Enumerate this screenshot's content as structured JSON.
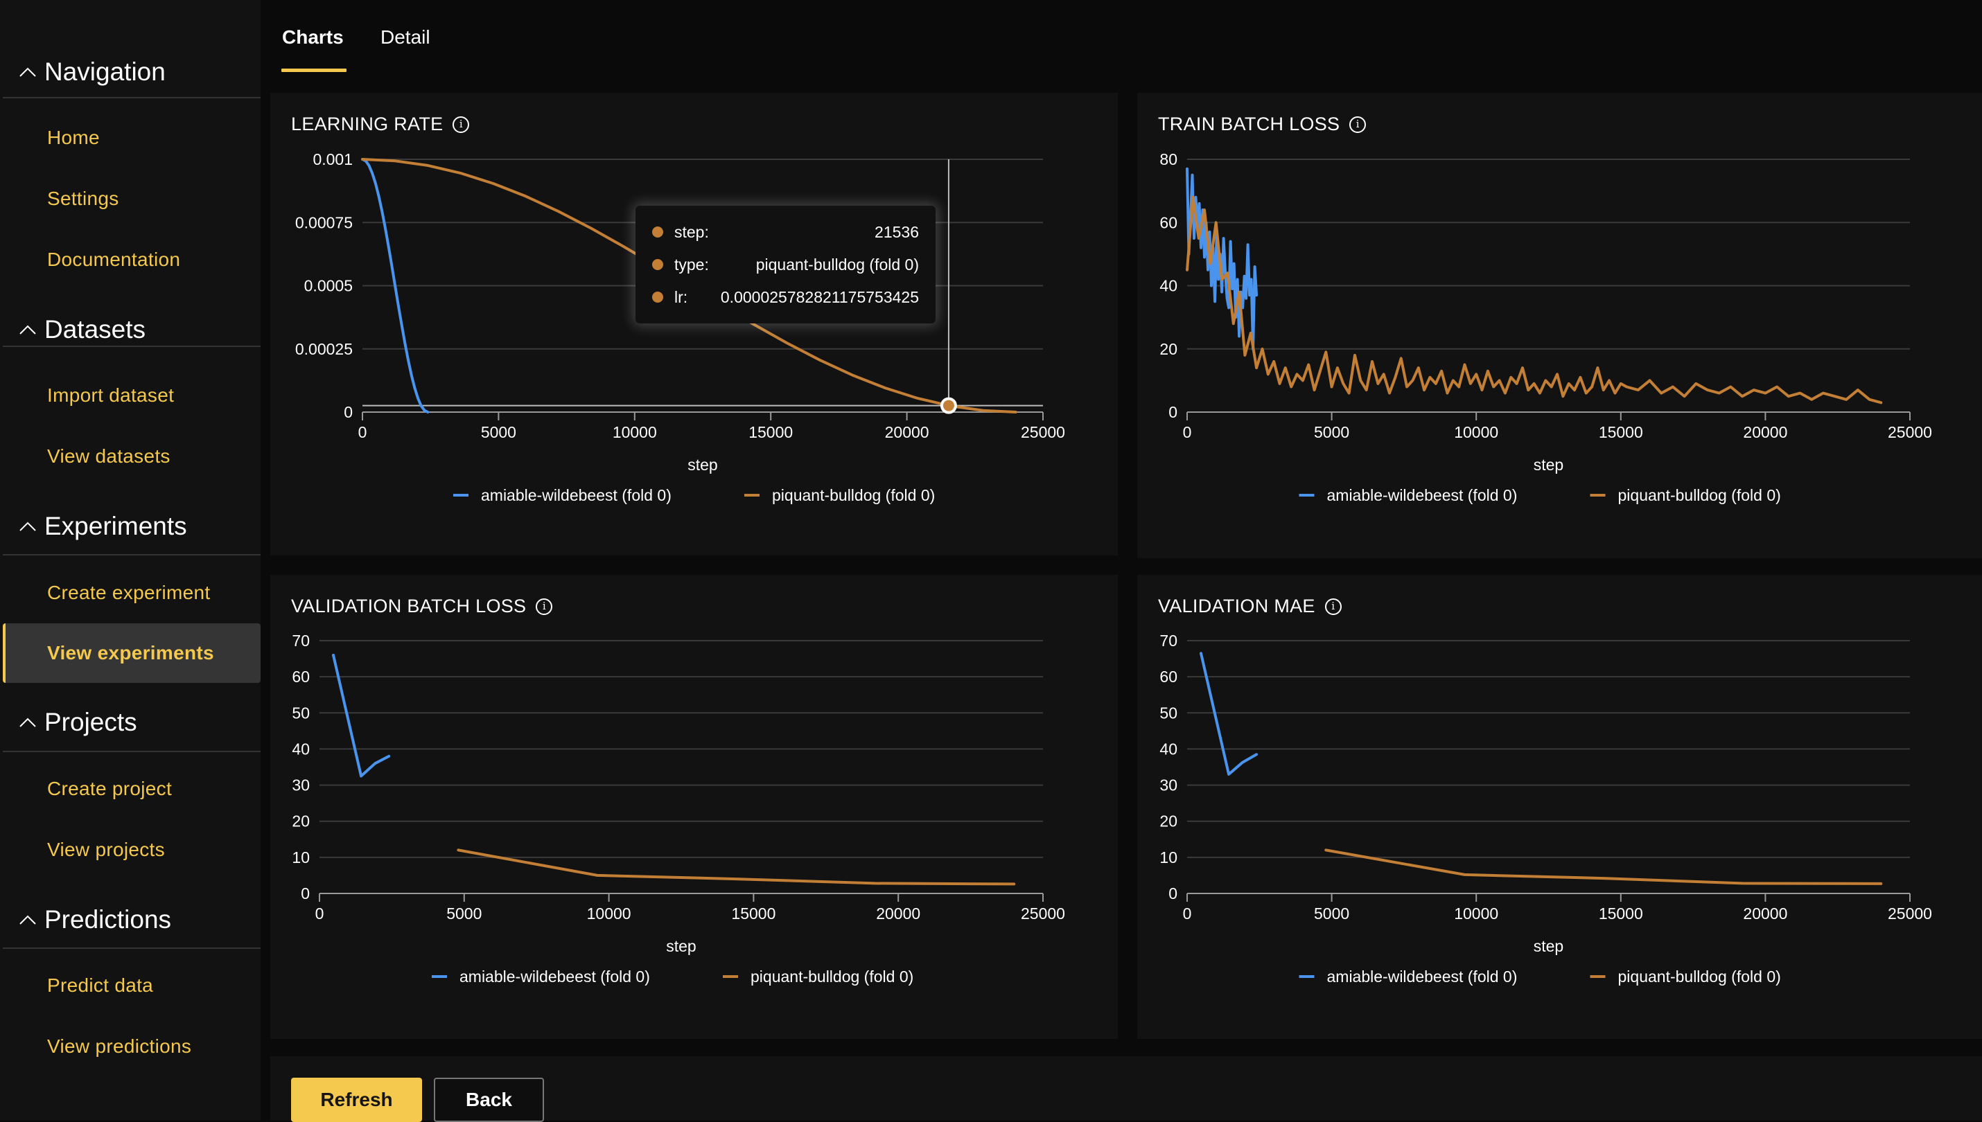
{
  "colors": {
    "accent": "#F5C94E",
    "series_blue": "#4A94EE",
    "series_orange": "#C27F35"
  },
  "sidebar": {
    "sections": [
      {
        "title": "Navigation",
        "items": [
          {
            "label": "Home"
          },
          {
            "label": "Settings"
          },
          {
            "label": "Documentation"
          }
        ]
      },
      {
        "title": "Datasets",
        "items": [
          {
            "label": "Import dataset"
          },
          {
            "label": "View datasets"
          }
        ]
      },
      {
        "title": "Experiments",
        "items": [
          {
            "label": "Create experiment"
          },
          {
            "label": "View experiments",
            "active": true
          }
        ]
      },
      {
        "title": "Projects",
        "items": [
          {
            "label": "Create project"
          },
          {
            "label": "View projects"
          }
        ]
      },
      {
        "title": "Predictions",
        "items": [
          {
            "label": "Predict data"
          },
          {
            "label": "View predictions"
          }
        ]
      }
    ]
  },
  "tabs": [
    {
      "label": "Charts",
      "active": true
    },
    {
      "label": "Detail",
      "active": false
    }
  ],
  "panels": [
    {
      "title": "LEARNING RATE",
      "info_icon": "info-icon"
    },
    {
      "title": "TRAIN BATCH LOSS",
      "info_icon": "info-icon"
    },
    {
      "title": "VALIDATION BATCH LOSS",
      "info_icon": "info-icon"
    },
    {
      "title": "VALIDATION MAE",
      "info_icon": "info-icon"
    }
  ],
  "tooltip": {
    "rows": [
      {
        "key": "step:",
        "value": "21536"
      },
      {
        "key": "type:",
        "value": "piquant-bulldog (fold 0)"
      },
      {
        "key": "lr:",
        "value": "0.000025782821175753425"
      }
    ]
  },
  "buttons": {
    "refresh": "Refresh",
    "back": "Back"
  },
  "chart_data": [
    {
      "type": "line",
      "title": "LEARNING RATE",
      "xlabel": "step",
      "ylabel": "",
      "xlim": [
        0,
        25000
      ],
      "ylim": [
        0,
        0.001
      ],
      "xticks": [
        0,
        5000,
        10000,
        15000,
        20000,
        25000
      ],
      "yticks": [
        0,
        0.00025,
        0.0005,
        0.00075,
        0.001
      ],
      "ytick_labels": [
        "0",
        "0.00025",
        "0.0005",
        "0.00075",
        "0.001"
      ],
      "grid": true,
      "legend": "bottom",
      "hover": {
        "step": 21536,
        "value": 2.5782821175753425e-05,
        "series": "piquant-bulldog (fold 0)"
      },
      "series": [
        {
          "name": "amiable-wildebeest (fold 0)",
          "color": "#4A94EE",
          "x": [
            0,
            120,
            240,
            360,
            480,
            600,
            720,
            840,
            960,
            1080,
            1200,
            1320,
            1440,
            1560,
            1680,
            1800,
            1920,
            2040,
            2160,
            2280,
            2400
          ],
          "y": [
            0.001,
            0.0009938,
            0.0009755,
            0.0009455,
            0.0009045,
            0.0008536,
            0.0007939,
            0.000727,
            0.0006545,
            0.0005782,
            0.0005,
            0.0004218,
            0.0003455,
            0.000273,
            0.0002061,
            0.0001464,
            9.55e-05,
            5.45e-05,
            2.45e-05,
            6.2e-06,
            0
          ]
        },
        {
          "name": "piquant-bulldog (fold 0)",
          "color": "#C27F35",
          "x": [
            0,
            1200,
            2400,
            3600,
            4800,
            6000,
            7200,
            8400,
            9600,
            10800,
            12000,
            13200,
            14400,
            15600,
            16800,
            18000,
            19200,
            20400,
            21600,
            22800,
            24000
          ],
          "y": [
            0.001,
            0.0009938,
            0.0009755,
            0.0009455,
            0.0009045,
            0.0008536,
            0.0007939,
            0.000727,
            0.0006545,
            0.0005782,
            0.0005,
            0.0004218,
            0.0003455,
            0.000273,
            0.0002061,
            0.0001464,
            9.55e-05,
            5.45e-05,
            2.45e-05,
            6.2e-06,
            0
          ]
        }
      ]
    },
    {
      "type": "line",
      "title": "TRAIN BATCH LOSS",
      "xlabel": "step",
      "ylabel": "",
      "xlim": [
        0,
        25000
      ],
      "ylim": [
        0,
        80
      ],
      "xticks": [
        0,
        5000,
        10000,
        15000,
        20000,
        25000
      ],
      "yticks": [
        0,
        20,
        40,
        60,
        80
      ],
      "ytick_labels": [
        "0",
        "20",
        "40",
        "60",
        "80"
      ],
      "grid": true,
      "legend": "bottom",
      "series": [
        {
          "name": "amiable-wildebeest (fold 0)",
          "color": "#4A94EE",
          "x": [
            0,
            60,
            120,
            180,
            240,
            300,
            360,
            420,
            480,
            540,
            600,
            660,
            720,
            780,
            840,
            900,
            960,
            1020,
            1080,
            1140,
            1200,
            1260,
            1320,
            1380,
            1440,
            1500,
            1560,
            1620,
            1680,
            1740,
            1800,
            1860,
            1920,
            1980,
            2040,
            2100,
            2160,
            2220,
            2280,
            2340,
            2400
          ],
          "y": [
            77,
            50,
            62,
            75,
            55,
            68,
            58,
            66,
            52,
            64,
            49,
            60,
            45,
            57,
            40,
            52,
            35,
            56,
            42,
            50,
            38,
            55,
            44,
            36,
            33,
            54,
            39,
            47,
            30,
            42,
            24,
            38,
            33,
            43,
            36,
            53,
            37,
            42,
            20,
            46,
            37
          ]
        },
        {
          "name": "piquant-bulldog (fold 0)",
          "color": "#C27F35",
          "x": [
            0,
            200,
            400,
            600,
            800,
            1000,
            1200,
            1400,
            1600,
            1800,
            2000,
            2200,
            2400,
            2600,
            2800,
            3000,
            3200,
            3400,
            3600,
            3800,
            4000,
            4200,
            4400,
            4600,
            4800,
            5000,
            5200,
            5400,
            5600,
            5800,
            6000,
            6200,
            6400,
            6600,
            6800,
            7000,
            7200,
            7400,
            7600,
            7800,
            8000,
            8200,
            8400,
            8600,
            8800,
            9000,
            9200,
            9400,
            9600,
            9800,
            10000,
            10200,
            10400,
            10600,
            10800,
            11000,
            11200,
            11400,
            11600,
            11800,
            12000,
            12200,
            12400,
            12600,
            12800,
            13000,
            13200,
            13400,
            13600,
            13800,
            14000,
            14200,
            14400,
            14600,
            14800,
            15000,
            15200,
            15600,
            16000,
            16400,
            16800,
            17200,
            17600,
            18000,
            18400,
            18800,
            19200,
            19600,
            20000,
            20400,
            20800,
            21200,
            21600,
            22000,
            22400,
            22800,
            23200,
            23600,
            24000
          ],
          "y": [
            45,
            68,
            55,
            64,
            47,
            60,
            42,
            44,
            28,
            38,
            18,
            25,
            14,
            20,
            12,
            16,
            9,
            14,
            8,
            12,
            10,
            15,
            7,
            13,
            19,
            8,
            14,
            9,
            6,
            18,
            10,
            7,
            16,
            9,
            12,
            6,
            11,
            17,
            8,
            10,
            14,
            7,
            11,
            9,
            13,
            6,
            10,
            8,
            15,
            9,
            12,
            7,
            13,
            8,
            10,
            6,
            11,
            9,
            14,
            7,
            9,
            6,
            10,
            8,
            12,
            5,
            9,
            7,
            11,
            6,
            8,
            14,
            7,
            10,
            6,
            9,
            8,
            7,
            10,
            6,
            8,
            5,
            9,
            7,
            6,
            8,
            5,
            7,
            6,
            8,
            5,
            6,
            4,
            6,
            5,
            4,
            7,
            4,
            3
          ]
        }
      ]
    },
    {
      "type": "line",
      "title": "VALIDATION BATCH LOSS",
      "xlabel": "step",
      "ylabel": "",
      "xlim": [
        0,
        25000
      ],
      "ylim": [
        0,
        70
      ],
      "xticks": [
        0,
        5000,
        10000,
        15000,
        20000,
        25000
      ],
      "yticks": [
        0,
        10,
        20,
        30,
        40,
        50,
        60,
        70
      ],
      "ytick_labels": [
        "0",
        "10",
        "20",
        "30",
        "40",
        "50",
        "60",
        "70"
      ],
      "grid": true,
      "legend": "bottom",
      "series": [
        {
          "name": "amiable-wildebeest (fold 0)",
          "color": "#4A94EE",
          "x": [
            480,
            1440,
            1920,
            2400
          ],
          "y": [
            66,
            32.5,
            36,
            38
          ]
        },
        {
          "name": "piquant-bulldog (fold 0)",
          "color": "#C27F35",
          "x": [
            4800,
            9600,
            14400,
            19200,
            24000
          ],
          "y": [
            12,
            5,
            4,
            2.8,
            2.6
          ]
        }
      ]
    },
    {
      "type": "line",
      "title": "VALIDATION MAE",
      "xlabel": "step",
      "ylabel": "",
      "xlim": [
        0,
        25000
      ],
      "ylim": [
        0,
        70
      ],
      "xticks": [
        0,
        5000,
        10000,
        15000,
        20000,
        25000
      ],
      "yticks": [
        0,
        10,
        20,
        30,
        40,
        50,
        60,
        70
      ],
      "ytick_labels": [
        "0",
        "10",
        "20",
        "30",
        "40",
        "50",
        "60",
        "70"
      ],
      "grid": true,
      "legend": "bottom",
      "series": [
        {
          "name": "amiable-wildebeest (fold 0)",
          "color": "#4A94EE",
          "x": [
            480,
            1440,
            1920,
            2400
          ],
          "y": [
            66.5,
            33,
            36.3,
            38.5
          ]
        },
        {
          "name": "piquant-bulldog (fold 0)",
          "color": "#C27F35",
          "x": [
            4800,
            9600,
            14400,
            19200,
            24000
          ],
          "y": [
            12,
            5.2,
            4.2,
            2.8,
            2.7
          ]
        }
      ]
    }
  ]
}
